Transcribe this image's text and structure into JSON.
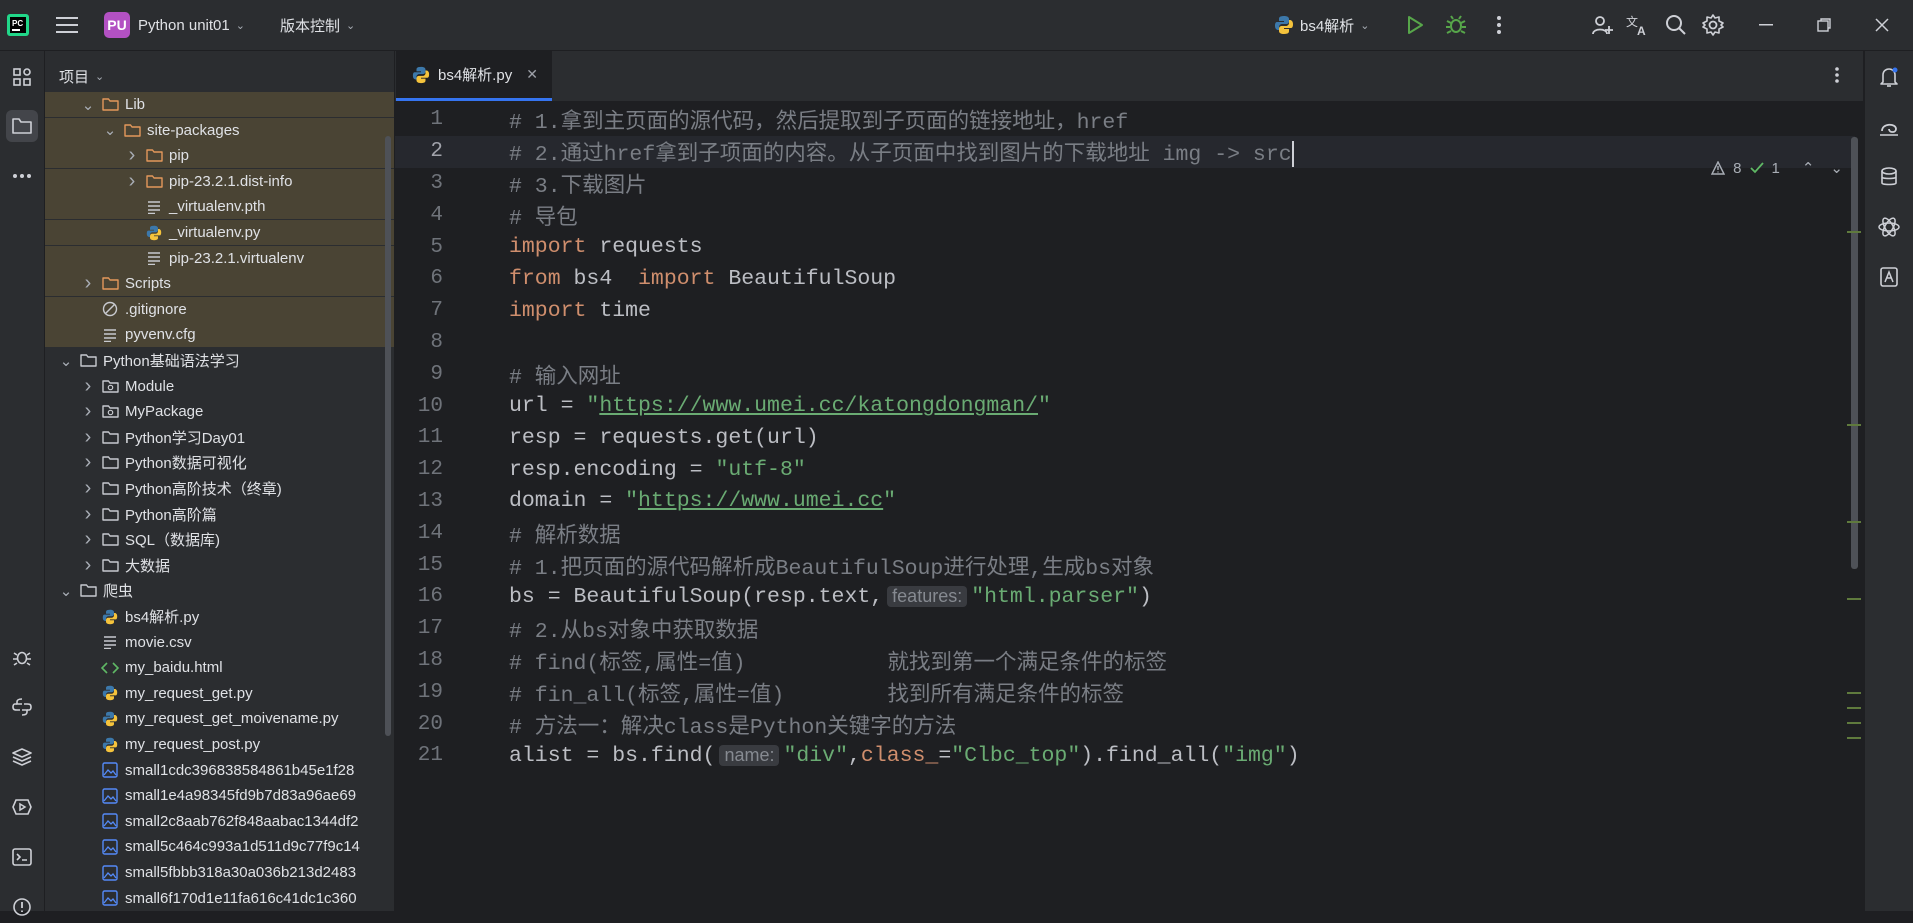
{
  "titlebar": {
    "project_badge": "PU",
    "project_name": "Python unit01",
    "vcs_menu": "版本控制",
    "run_config": "bs4解析"
  },
  "project_panel": {
    "title": "项目",
    "items": [
      {
        "label": "Lib",
        "indent": 2,
        "type": "folder-orange",
        "expanded": true
      },
      {
        "label": "site-packages",
        "indent": 3,
        "type": "folder-orange",
        "expanded": true
      },
      {
        "label": "pip",
        "indent": 4,
        "type": "folder-orange",
        "expanded": false
      },
      {
        "label": "pip-23.2.1.dist-info",
        "indent": 4,
        "type": "folder-orange",
        "expanded": false
      },
      {
        "label": "_virtualenv.pth",
        "indent": 4,
        "type": "text-file"
      },
      {
        "label": "_virtualenv.py",
        "indent": 4,
        "type": "python-file"
      },
      {
        "label": "pip-23.2.1.virtualenv",
        "indent": 4,
        "type": "text-file"
      },
      {
        "label": "Scripts",
        "indent": 2,
        "type": "folder-orange",
        "expanded": false
      },
      {
        "label": ".gitignore",
        "indent": 2,
        "type": "ignore-file"
      },
      {
        "label": "pyvenv.cfg",
        "indent": 2,
        "type": "text-file"
      },
      {
        "label": "Python基础语法学习",
        "indent": 1,
        "type": "folder",
        "expanded": true
      },
      {
        "label": "Module",
        "indent": 2,
        "type": "package",
        "expanded": false
      },
      {
        "label": "MyPackage",
        "indent": 2,
        "type": "package",
        "expanded": false
      },
      {
        "label": "Python学习Day01",
        "indent": 2,
        "type": "folder",
        "expanded": false
      },
      {
        "label": "Python数据可视化",
        "indent": 2,
        "type": "folder",
        "expanded": false
      },
      {
        "label": "Python高阶技术（终章)",
        "indent": 2,
        "type": "folder",
        "expanded": false
      },
      {
        "label": "Python高阶篇",
        "indent": 2,
        "type": "folder",
        "expanded": false
      },
      {
        "label": "SQL（数据库)",
        "indent": 2,
        "type": "folder",
        "expanded": false
      },
      {
        "label": "大数据",
        "indent": 2,
        "type": "folder",
        "expanded": false
      },
      {
        "label": "爬虫",
        "indent": 1,
        "type": "folder",
        "expanded": true
      },
      {
        "label": "bs4解析.py",
        "indent": 2,
        "type": "python-file"
      },
      {
        "label": "movie.csv",
        "indent": 2,
        "type": "text-file"
      },
      {
        "label": "my_baidu.html",
        "indent": 2,
        "type": "html-file"
      },
      {
        "label": "my_request_get.py",
        "indent": 2,
        "type": "python-file"
      },
      {
        "label": "my_request_get_moivename.py",
        "indent": 2,
        "type": "python-file"
      },
      {
        "label": "my_request_post.py",
        "indent": 2,
        "type": "python-file"
      },
      {
        "label": "small1cdc396838584861b45e1f28",
        "indent": 2,
        "type": "image-file"
      },
      {
        "label": "small1e4a98345fd9b7d83a96ae69",
        "indent": 2,
        "type": "image-file"
      },
      {
        "label": "small2c8aab762f848aabac1344df2",
        "indent": 2,
        "type": "image-file"
      },
      {
        "label": "small5c464c993a1d511d9c77f9c14",
        "indent": 2,
        "type": "image-file"
      },
      {
        "label": "small5fbbb318a30a036b213d2483",
        "indent": 2,
        "type": "image-file"
      },
      {
        "label": "small6f170d1e11fa616c41dc1c360",
        "indent": 2,
        "type": "image-file"
      }
    ]
  },
  "editor": {
    "tab_label": "bs4解析.py",
    "warnings": "8",
    "weak_warnings": "1",
    "current_line": 2,
    "lines": [
      {
        "n": "1",
        "parts": [
          {
            "t": "# 1.拿到主页面的源代码，然后提取到子页面的链接地址，href",
            "c": "cm"
          }
        ]
      },
      {
        "n": "2",
        "parts": [
          {
            "t": "# 2.通过href拿到子项面的内容。从子页面中找到图片的下载地址 img -> src",
            "c": "cm"
          }
        ]
      },
      {
        "n": "3",
        "parts": [
          {
            "t": "# 3.下载图片",
            "c": "cm"
          }
        ]
      },
      {
        "n": "4",
        "parts": [
          {
            "t": "# 导包",
            "c": "cm"
          }
        ]
      },
      {
        "n": "5",
        "parts": [
          {
            "t": "import",
            "c": "kw"
          },
          {
            "t": " requests",
            "c": ""
          }
        ]
      },
      {
        "n": "6",
        "parts": [
          {
            "t": "from",
            "c": "kw"
          },
          {
            "t": " bs4  ",
            "c": ""
          },
          {
            "t": "import",
            "c": "kw"
          },
          {
            "t": " BeautifulSoup",
            "c": ""
          }
        ]
      },
      {
        "n": "7",
        "parts": [
          {
            "t": "import",
            "c": "kw"
          },
          {
            "t": " time",
            "c": ""
          }
        ]
      },
      {
        "n": "8",
        "parts": []
      },
      {
        "n": "9",
        "parts": [
          {
            "t": "# 输入网址",
            "c": "cm"
          }
        ]
      },
      {
        "n": "10",
        "parts": [
          {
            "t": "url = ",
            "c": ""
          },
          {
            "t": "\"",
            "c": "str"
          },
          {
            "t": "https://www.umei.cc/katongdongman/",
            "c": "url"
          },
          {
            "t": "\"",
            "c": "str"
          }
        ]
      },
      {
        "n": "11",
        "parts": [
          {
            "t": "resp = requests.get(url)",
            "c": ""
          }
        ]
      },
      {
        "n": "12",
        "parts": [
          {
            "t": "resp.encoding = ",
            "c": ""
          },
          {
            "t": "\"utf-8\"",
            "c": "str"
          }
        ]
      },
      {
        "n": "13",
        "parts": [
          {
            "t": "domain = ",
            "c": ""
          },
          {
            "t": "\"",
            "c": "str"
          },
          {
            "t": "https://www.umei.cc",
            "c": "url"
          },
          {
            "t": "\"",
            "c": "str"
          }
        ]
      },
      {
        "n": "14",
        "parts": [
          {
            "t": "# 解析数据",
            "c": "cm"
          }
        ]
      },
      {
        "n": "15",
        "parts": [
          {
            "t": "# 1.把页面的源代码解析成BeautifulSoup进行处理,生成bs对象",
            "c": "cm"
          }
        ]
      },
      {
        "n": "16",
        "parts": [
          {
            "t": "bs = BeautifulSoup(resp.text,",
            "c": ""
          },
          {
            "t": "features:",
            "c": "hint"
          },
          {
            "t": "\"html.parser\"",
            "c": "str"
          },
          {
            "t": ")",
            "c": ""
          }
        ]
      },
      {
        "n": "17",
        "parts": [
          {
            "t": "# 2.从bs对象中获取数据",
            "c": "cm"
          }
        ]
      },
      {
        "n": "18",
        "parts": [
          {
            "t": "# find(标签,属性=值)           就找到第一个满足条件的标签",
            "c": "cm"
          }
        ]
      },
      {
        "n": "19",
        "parts": [
          {
            "t": "# fin_all(标签,属性=值)        找到所有满足条件的标签",
            "c": "cm"
          }
        ]
      },
      {
        "n": "20",
        "parts": [
          {
            "t": "# 方法一：解决class是Python关键字的方法",
            "c": "cm"
          }
        ]
      },
      {
        "n": "21",
        "parts": [
          {
            "t": "alist = bs.find(",
            "c": ""
          },
          {
            "t": "name:",
            "c": "hint"
          },
          {
            "t": "\"div\"",
            "c": "str"
          },
          {
            "t": ",",
            "c": ""
          },
          {
            "t": "class_",
            "c": "kw"
          },
          {
            "t": "=",
            "c": ""
          },
          {
            "t": "\"Clbc_top\"",
            "c": "str"
          },
          {
            "t": ").find_all(",
            "c": ""
          },
          {
            "t": "\"img\"",
            "c": "str"
          },
          {
            "t": ")",
            "c": ""
          }
        ]
      }
    ]
  }
}
